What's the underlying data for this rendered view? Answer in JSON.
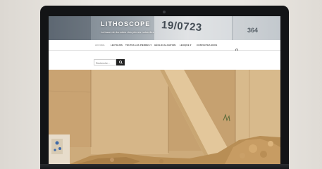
{
  "site": {
    "title": "LITHOSCOPE",
    "description": "La base de données des pierres naturelles"
  },
  "header_image": {
    "block_numbers": [
      "19/0723",
      "364"
    ]
  },
  "nav": {
    "items": [
      {
        "label": "ACCUEIL",
        "active": true
      },
      {
        "label": "LECTEURS",
        "active": false
      },
      {
        "label": "TOUTES LES PIERRES",
        "dropdown": true,
        "active": false
      },
      {
        "label": "GÉOLOCALISATION",
        "active": false
      },
      {
        "label": "LEXIQUE",
        "dropdown": true,
        "active": false
      },
      {
        "label": "CONTACTEZ-NOUS",
        "active": false
      }
    ],
    "search_icon": "search-icon"
  },
  "search": {
    "placeholder": "Recherche…"
  },
  "colors": {
    "nav_text": "#444444",
    "nav_active": "#9a9a9a",
    "search_button": "#222222",
    "stone": "#d2b285"
  }
}
